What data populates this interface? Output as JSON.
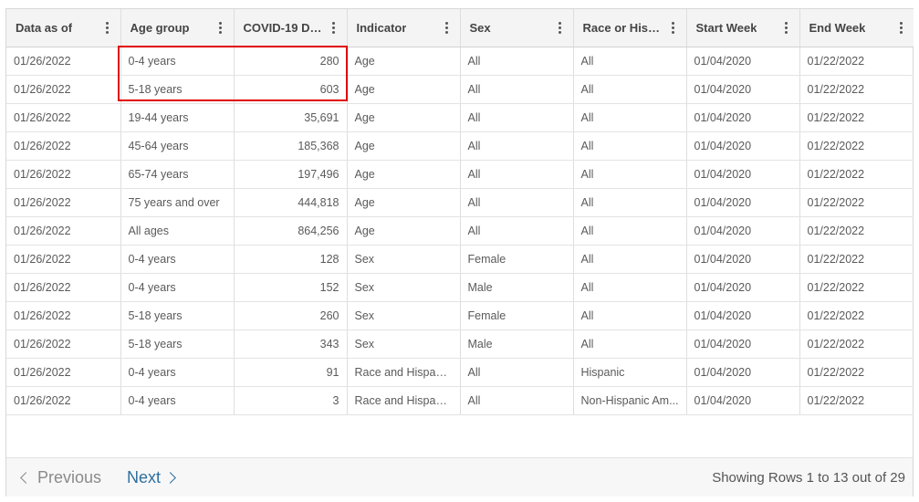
{
  "columns": [
    "Data as of",
    "Age group",
    "COVID-19 De...",
    "Indicator",
    "Sex",
    "Race or Hisp...",
    "Start Week",
    "End Week"
  ],
  "rows": [
    [
      "01/26/2022",
      "0-4 years",
      "280",
      "Age",
      "All",
      "All",
      "01/04/2020",
      "01/22/2022"
    ],
    [
      "01/26/2022",
      "5-18 years",
      "603",
      "Age",
      "All",
      "All",
      "01/04/2020",
      "01/22/2022"
    ],
    [
      "01/26/2022",
      "19-44 years",
      "35,691",
      "Age",
      "All",
      "All",
      "01/04/2020",
      "01/22/2022"
    ],
    [
      "01/26/2022",
      "45-64 years",
      "185,368",
      "Age",
      "All",
      "All",
      "01/04/2020",
      "01/22/2022"
    ],
    [
      "01/26/2022",
      "65-74 years",
      "197,496",
      "Age",
      "All",
      "All",
      "01/04/2020",
      "01/22/2022"
    ],
    [
      "01/26/2022",
      "75 years and over",
      "444,818",
      "Age",
      "All",
      "All",
      "01/04/2020",
      "01/22/2022"
    ],
    [
      "01/26/2022",
      "All ages",
      "864,256",
      "Age",
      "All",
      "All",
      "01/04/2020",
      "01/22/2022"
    ],
    [
      "01/26/2022",
      "0-4 years",
      "128",
      "Sex",
      "Female",
      "All",
      "01/04/2020",
      "01/22/2022"
    ],
    [
      "01/26/2022",
      "0-4 years",
      "152",
      "Sex",
      "Male",
      "All",
      "01/04/2020",
      "01/22/2022"
    ],
    [
      "01/26/2022",
      "5-18 years",
      "260",
      "Sex",
      "Female",
      "All",
      "01/04/2020",
      "01/22/2022"
    ],
    [
      "01/26/2022",
      "5-18 years",
      "343",
      "Sex",
      "Male",
      "All",
      "01/04/2020",
      "01/22/2022"
    ],
    [
      "01/26/2022",
      "0-4 years",
      "91",
      "Race and Hispani...",
      "All",
      "Hispanic",
      "01/04/2020",
      "01/22/2022"
    ],
    [
      "01/26/2022",
      "0-4 years",
      "3",
      "Race and Hispani...",
      "All",
      "Non-Hispanic Am...",
      "01/04/2020",
      "01/22/2022"
    ]
  ],
  "pagination": {
    "previous_label": "Previous",
    "next_label": "Next",
    "rows_info": "Showing Rows 1 to 13 out of 29"
  },
  "icons": {
    "column_menu": "kebab-menu-icon",
    "previous": "chevron-left-icon",
    "next": "chevron-right-icon"
  },
  "colors": {
    "highlight": "#e00000",
    "link": "#2e6fa0",
    "header_bg": "#f4f4f4"
  }
}
